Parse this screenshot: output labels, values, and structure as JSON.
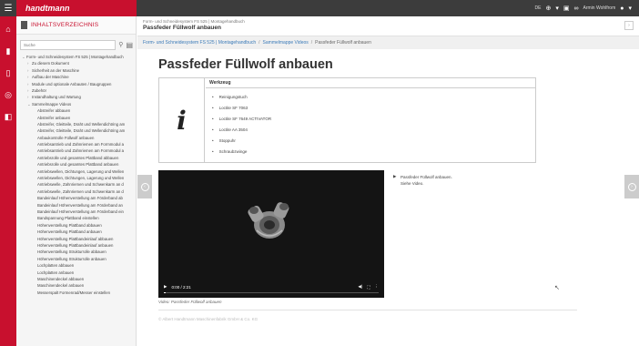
{
  "brand": {
    "logo": "handtmann",
    "accent": "#c8102e"
  },
  "topbar": {
    "language": "DE",
    "user": "Armin Wohlfrom"
  },
  "sidebar": {
    "title": "INHALTSVERZEICHNIS",
    "search_placeholder": "Suche",
    "tree": [
      {
        "label": "Form- und Schneidesystem FS 525 | Montagehandbuch",
        "level": 0,
        "chevron": "⌄"
      },
      {
        "label": "Zu diesem Dokument",
        "level": 1,
        "chevron": "›"
      },
      {
        "label": "Sicherheit an der Maschine",
        "level": 1,
        "chevron": "›"
      },
      {
        "label": "Aufbau der Maschine",
        "level": 1,
        "chevron": "›"
      },
      {
        "label": "Module und optionale Anbauten / Baugruppen",
        "level": 1,
        "chevron": "›"
      },
      {
        "label": "Zubehör",
        "level": 1,
        "chevron": "›"
      },
      {
        "label": "Instandhaltung und Wartung",
        "level": 1,
        "chevron": "›"
      },
      {
        "label": "Sammelmappe Videos",
        "level": 1,
        "chevron": "⌄"
      },
      {
        "label": "Abstreifer abbauen",
        "level": 2,
        "chevron": ""
      },
      {
        "label": "Abstreifer anbauen",
        "level": 2,
        "chevron": ""
      },
      {
        "label": "Abstreifer, Gleitteile, Draht und Wellendichtring am",
        "level": 2,
        "chevron": ""
      },
      {
        "label": "Abstreifer, Gleitteile, Draht und Wellendichtring am",
        "level": 2,
        "chevron": ""
      },
      {
        "label": "Anbaukontrolle Füllwolf anbauen",
        "level": 2,
        "chevron": ""
      },
      {
        "label": "Antriebsantrieb und Zahnriemen am Formmodul a",
        "level": 2,
        "chevron": ""
      },
      {
        "label": "Antriebsantrieb und Zahnriemen am Formmodul a",
        "level": 2,
        "chevron": ""
      },
      {
        "label": "Antriebsrolle und gesamtes Plattband abbauen",
        "level": 2,
        "chevron": ""
      },
      {
        "label": "Antriebsrolle und gesamtes Plattband anbauen",
        "level": 2,
        "chevron": ""
      },
      {
        "label": "Antriebswellen, Dichtungen, Lagerung und Wellen",
        "level": 2,
        "chevron": ""
      },
      {
        "label": "Antriebswellen, Dichtungen, Lagerung und Wellen",
        "level": 2,
        "chevron": ""
      },
      {
        "label": "Antriebswelle, Zahnriemen und Schwenkarm an d",
        "level": 2,
        "chevron": ""
      },
      {
        "label": "Antriebswelle, Zahnriemen und Schwenkarm an d",
        "level": 2,
        "chevron": ""
      },
      {
        "label": "Bandeinlauf Höhenverstellung am Förderband ab",
        "level": 2,
        "chevron": ""
      },
      {
        "label": "Bandeinlauf Höhenverstellung am Förderband an",
        "level": 2,
        "chevron": ""
      },
      {
        "label": "Bandeinlauf Höhenverstellung am Förderband ein",
        "level": 2,
        "chevron": ""
      },
      {
        "label": "Bandspannung Plattband einstellen",
        "level": 2,
        "chevron": ""
      },
      {
        "label": "Höhenverstellung Plattband abbauen",
        "level": 2,
        "chevron": ""
      },
      {
        "label": "Höhenverstellung Plattband anbauen",
        "level": 2,
        "chevron": ""
      },
      {
        "label": "Höhenverstellung Plattbandeinlauf abbauen",
        "level": 2,
        "chevron": ""
      },
      {
        "label": "Höhenverstellung Plattbandeinlauf anbauen",
        "level": 2,
        "chevron": ""
      },
      {
        "label": "Höhenverstellung Strukturrolle abbauen",
        "level": 2,
        "chevron": ""
      },
      {
        "label": "Höhenverstellung Strukturrolle anbauen",
        "level": 2,
        "chevron": ""
      },
      {
        "label": "Lochplatten abbauen",
        "level": 2,
        "chevron": ""
      },
      {
        "label": "Lochplatten anbauen",
        "level": 2,
        "chevron": ""
      },
      {
        "label": "Maschinendeckel abbauen",
        "level": 2,
        "chevron": ""
      },
      {
        "label": "Maschinendeckel anbauen",
        "level": 2,
        "chevron": ""
      },
      {
        "label": "Messerspalt Formenrad/Messer einstellen",
        "level": 2,
        "chevron": ""
      }
    ]
  },
  "header": {
    "path": "Form- und Schneidesystem FS 525 | Montagehandbuch",
    "document_title": "Passfeder Füllwolf anbauen"
  },
  "breadcrumb": [
    "Form- und Schneidesystem FS 525 | Montagehandbuch",
    "Sammelmappe Videos",
    "Passfeder Füllwolf anbauen"
  ],
  "content": {
    "title": "Passfeder Füllwolf anbauen",
    "info_glyph": "i",
    "tools_header": "Werkzeug",
    "tools": [
      "Reinigungstuch",
      "Loctite SF 7063",
      "Loctite SF 7649 ACTIVATOR",
      "Loctite AA 3504",
      "Stoppuhr",
      "Schraubzwinge"
    ],
    "step_lines": [
      "Passfeder Füllwolf anbauen.",
      "Siehe Video."
    ],
    "video": {
      "time": "0:00 / 2:21",
      "progress": 0.0,
      "caption": "Video: Passfeder Füllwolf anbauen"
    },
    "footer": "© Albert Handtmann Maschinenfabrik GmbH & Co. KG"
  }
}
